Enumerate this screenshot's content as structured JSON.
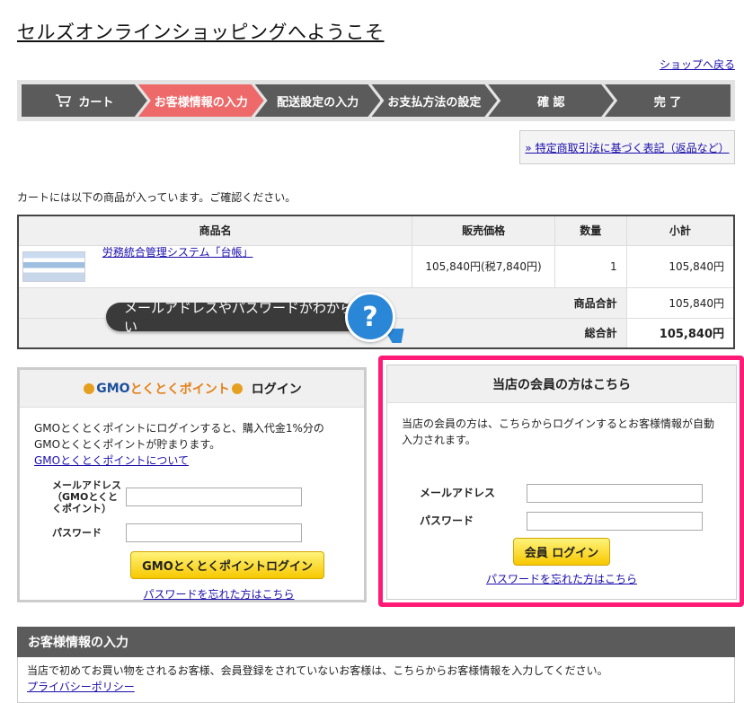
{
  "header": {
    "site_title": "セルズオンラインショッピングへようこそ",
    "back_link": "ショップへ戻る"
  },
  "steps": [
    {
      "label": "カート",
      "icon": "cart-icon",
      "active": false
    },
    {
      "label": "お客様情報の入力",
      "active": true
    },
    {
      "label": "配送設定の入力",
      "active": false
    },
    {
      "label": "お支払方法の設定",
      "active": false
    },
    {
      "label": "確 認",
      "active": false
    },
    {
      "label": "完 了",
      "active": false
    }
  ],
  "law_link": "» 特定商取引法に基づく表記（返品など）",
  "cart": {
    "message": "カートには以下の商品が入っています。ご確認ください。",
    "headers": [
      "商品名",
      "販売価格",
      "数量",
      "小計"
    ],
    "items": [
      {
        "name": "労務統合管理システム「台帳」",
        "price": "105,840円(税7,840円)",
        "qty": "1",
        "subtotal": "105,840円"
      }
    ],
    "subtotal_label": "商品合計",
    "subtotal_value": "105,840円",
    "total_label": "総合計",
    "total_value": "105,840円"
  },
  "tooltip": {
    "text": "メールアドレスやパスワードがわからない",
    "badge": "?"
  },
  "gmo_login": {
    "logo_gmo": "GMO",
    "logo_text": "とくとくポイント",
    "title": "ログイン",
    "desc": "GMOとくとくポイントにログインすると、購入代金1%分のGMOとくとくポイントが貯まります。",
    "about_link": "GMOとくとくポイントについて",
    "email_label": "メールアドレス（GMOとくとくポイント）",
    "password_label": "パスワード",
    "button": "GMOとくとくポイントログイン",
    "forgot": "パスワードを忘れた方はこちら"
  },
  "member_login": {
    "title": "当店の会員の方はこちら",
    "desc": "当店の会員の方は、こちらからログインするとお客様情報が自動入力されます。",
    "email_label": "メールアドレス",
    "password_label": "パスワード",
    "button": "会員 ログイン",
    "forgot": "パスワードを忘れた方はこちら"
  },
  "customer": {
    "title": "お客様情報の入力",
    "desc": "当店で初めてお買い物をされるお客様、会員登録をされていないお客様は、こちらからお客様情報を入力してください。",
    "privacy_link": "プライバシーポリシー"
  },
  "colors": {
    "active_step": "#ee6a6a",
    "step": "#5b5b5b",
    "highlight_frame": "#ff1a75",
    "help_badge": "#2a86d6",
    "button_yellow": "#f7c800"
  }
}
